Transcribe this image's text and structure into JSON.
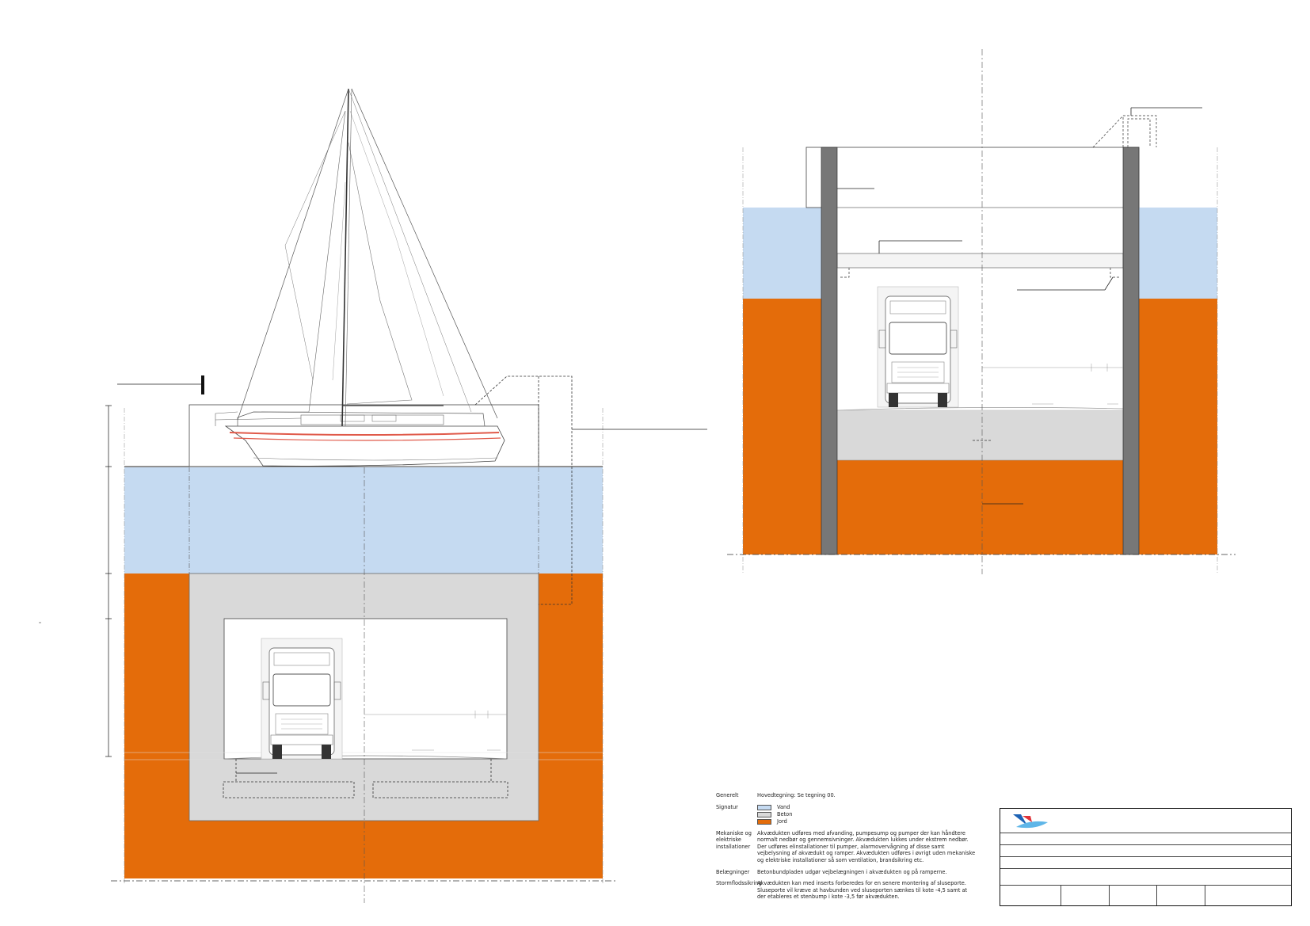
{
  "notes": {
    "generelt": {
      "label": "Generelt",
      "text": "Hovedtegning: Se tegning 00."
    },
    "signatur": {
      "label": "Signatur",
      "legend": [
        {
          "name": "Vand",
          "color": "#c5daf1"
        },
        {
          "name": "Beton",
          "color": "#d9d9d9"
        },
        {
          "name": "Jord",
          "color": "#e46c0a"
        }
      ]
    },
    "mekaniske": {
      "label": "Mekaniske og elektriske installationer",
      "text": "Akvædukten udføres med afvanding, pumpesump og pumper der kan håndtere normalt nedbør og gennemsivninger. Akvædukten lukkes under ekstrem nedbør. Der udføres elinstallationer til pumper, alarmovervågning af disse samt vejbelysning af akvædukt og ramper. Akvædukten udføres i øvrigt uden mekaniske og elektriske installationer så som ventilation, brandsikring etc."
    },
    "belaegninger": {
      "label": "Belægninger",
      "text": "Betonbundpladen udgør vejbelægningen i akvædukten og på ramperne."
    },
    "stormflod": {
      "label": "Stormflodssikring",
      "text": "Akvædukten kan med inserts forberedes for en senere montering af sluseporte. Sluseporte vil kræve at havbunden ved sluseporten sænkes til kote -4,5 samt at der etableres et stenbump i kote -3,5 før akvædukten."
    }
  },
  "colors": {
    "water": "#c5daf1",
    "concrete": "#d9d9d9",
    "soil": "#e46c0a",
    "steel": "#777777"
  },
  "icons": {
    "logo": "wave-logo-icon"
  }
}
